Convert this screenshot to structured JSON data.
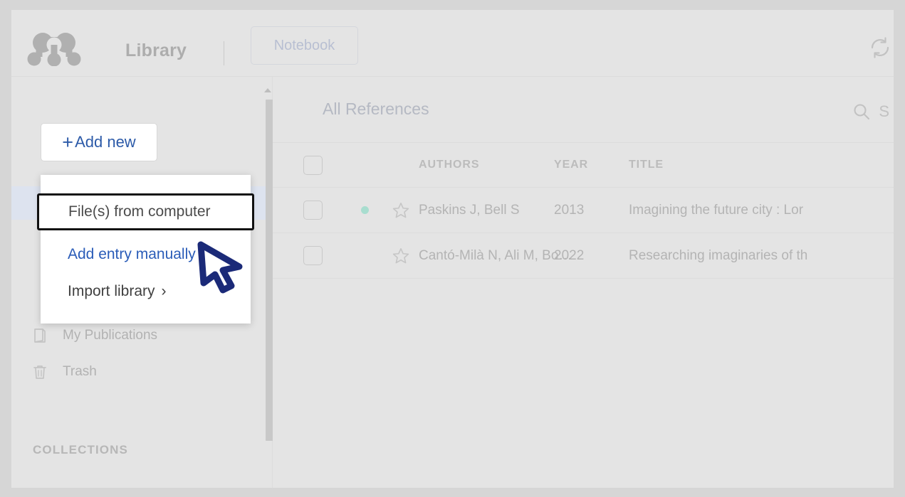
{
  "colors": {
    "page_background": "#d6d6d6",
    "app_background": "#e4e4e4",
    "accent_blue": "#2c5aa8",
    "link_blue": "#2a5cb8",
    "focus_outline": "#111111",
    "cursor_navy": "#1b2a78",
    "unread_dot_teal": "#a8ddcf",
    "sidebar_highlight": "#dde3ef",
    "muted_text": "#b4b4b4"
  },
  "topbar": {
    "logo_icon": "mendeley-logo-icon",
    "title": "Library",
    "notebook_label": "Notebook",
    "sync_icon": "sync-refresh-icon"
  },
  "sidebar": {
    "add_new": {
      "plus_glyph": "+",
      "label": "Add new"
    },
    "items": [
      {
        "label": "My Publications",
        "icon": "publications-icon"
      },
      {
        "label": "Trash",
        "icon": "trash-icon"
      }
    ],
    "collections_header": "COLLECTIONS"
  },
  "dropdown": {
    "items": [
      {
        "label": "File(s) from computer",
        "state": "focused",
        "icon": ""
      },
      {
        "label": "Add entry manually",
        "state": "link",
        "icon": ""
      },
      {
        "label": "Import library",
        "state": "plain",
        "icon": "chevron-right-icon",
        "chevron": "›"
      }
    ]
  },
  "main": {
    "heading": "All References",
    "search": {
      "icon": "search-icon",
      "label": "S"
    },
    "table": {
      "columns": [
        "",
        "",
        "",
        "AUTHORS",
        "YEAR",
        "TITLE"
      ],
      "headers": {
        "authors": "AUTHORS",
        "year": "YEAR",
        "title": "TITLE"
      },
      "rows": [
        {
          "checked": false,
          "unread": true,
          "starred": false,
          "authors": "Paskins J, Bell S",
          "year": "2013",
          "title": "Imagining the future city : Lor"
        },
        {
          "checked": false,
          "unread": false,
          "starred": false,
          "authors": "Cantó-Milà N, Ali M, Bo…",
          "year": "2022",
          "title": "Researching imaginaries of th"
        }
      ]
    }
  },
  "cursor": {
    "icon": "mouse-pointer-cursor"
  }
}
